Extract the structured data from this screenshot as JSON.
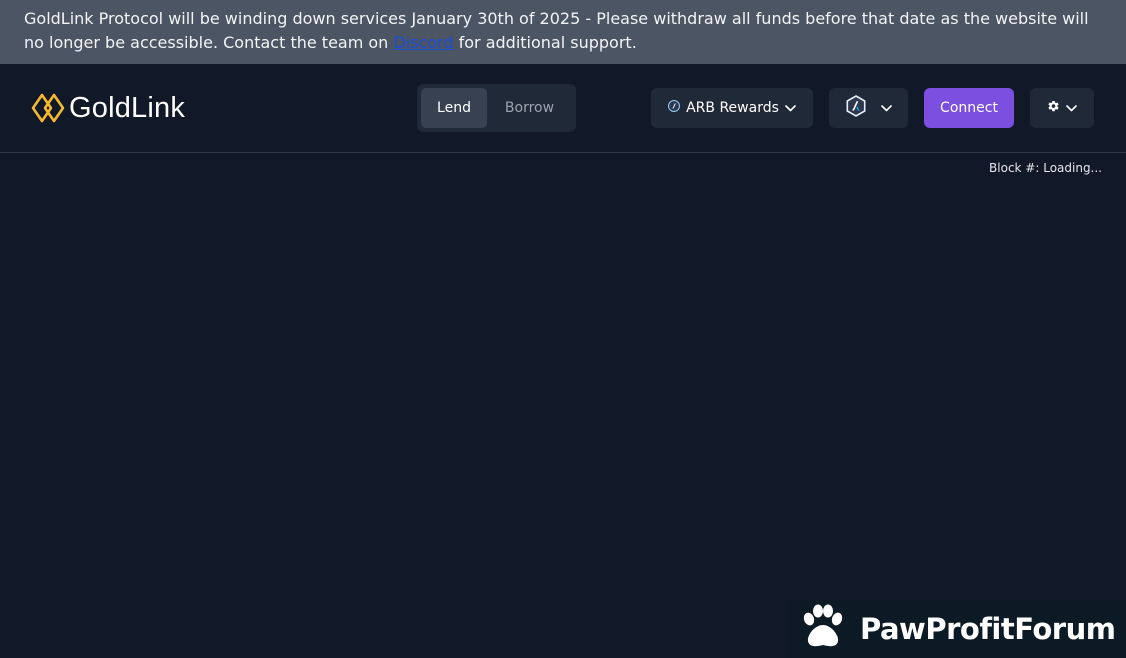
{
  "banner": {
    "text_before": "GoldLink Protocol will be winding down services January 30th of 2025 - Please withdraw all funds before that date as the website will no longer be accessible. Contact the team on ",
    "link_text": "Discord",
    "text_after": " for additional support."
  },
  "header": {
    "logo_text": "GoldLink",
    "tabs": [
      {
        "label": "Lend",
        "active": true
      },
      {
        "label": "Borrow",
        "active": false
      }
    ],
    "arb_rewards_label": "ARB Rewards",
    "connect_label": "Connect",
    "icons": {
      "logo": "goldlink-logo-icon",
      "arb": "arbitrum-icon",
      "network": "arbitrum-network-icon",
      "settings": "gear-icon",
      "chevron": "chevron-down-icon"
    }
  },
  "status": {
    "block_label": "Block #: Loading..."
  },
  "watermark": {
    "text": "PawProfitForum",
    "icon": "paw-icon"
  },
  "colors": {
    "background": "#111827",
    "banner_bg": "#4b5563",
    "accent_gold": "#f5b82e",
    "connect_purple": "#7c4fe0",
    "control_bg": "#1f2937"
  }
}
